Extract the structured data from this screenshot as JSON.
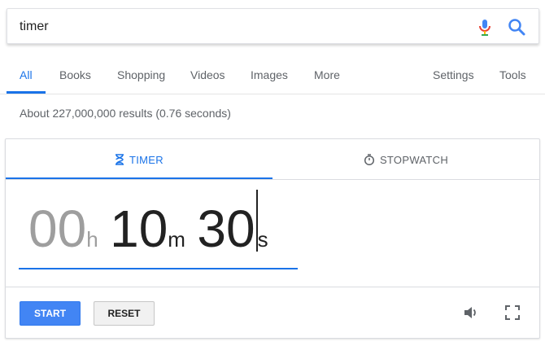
{
  "search": {
    "query": "timer"
  },
  "nav": {
    "tabs": [
      {
        "label": "All",
        "active": true
      },
      {
        "label": "Books"
      },
      {
        "label": "Shopping"
      },
      {
        "label": "Videos"
      },
      {
        "label": "Images"
      },
      {
        "label": "More"
      }
    ],
    "settings_label": "Settings",
    "tools_label": "Tools"
  },
  "result_stats": "About 227,000,000 results (0.76 seconds)",
  "timer_widget": {
    "tabs": [
      {
        "label": "TIMER",
        "icon": "hourglass-icon",
        "active": true
      },
      {
        "label": "STOPWATCH",
        "icon": "stopwatch-icon"
      }
    ],
    "hours": "00",
    "hours_unit": "h",
    "minutes": "10",
    "minutes_unit": "m",
    "seconds": "30",
    "seconds_unit": "s",
    "start_label": "START",
    "reset_label": "RESET",
    "icons": [
      "volume-icon",
      "fullscreen-icon"
    ]
  },
  "colors": {
    "accent": "#1a73e8",
    "start_button": "#4285f4",
    "dim_digits": "#9e9e9e"
  }
}
